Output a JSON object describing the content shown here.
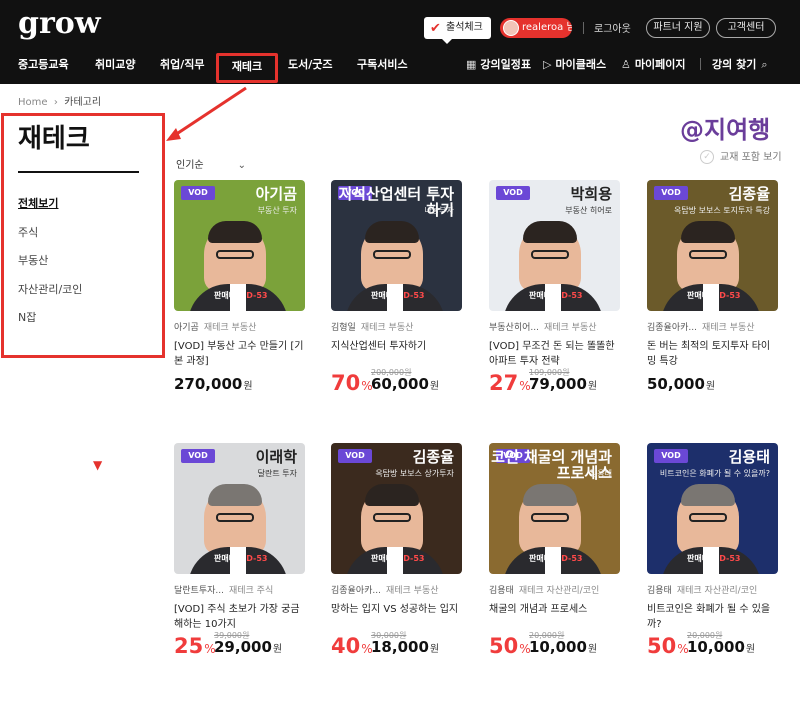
{
  "header": {
    "logo": "grow",
    "attendance": "출석체크",
    "username": "realeroa 님 ›",
    "logout": "로그아웃",
    "partner": "파트너 지원",
    "support": "고객센터",
    "nav": [
      "중고등교육",
      "취미교양",
      "취업/직무",
      "재테크",
      "도서/굿즈",
      "구독서비스"
    ],
    "nav_right": [
      "강의일정표",
      "마이클래스",
      "마이페이지",
      "강의 찾기"
    ]
  },
  "breadcrumb": {
    "home": "Home",
    "current": "카테고리"
  },
  "sidebar": {
    "title": "재테크",
    "items": [
      "전체보기",
      "주식",
      "부동산",
      "자산관리/코인",
      "N잡"
    ]
  },
  "watermark": "@지여행",
  "sort": {
    "label": "인기순"
  },
  "textbook_toggle": "교재 포함 보기",
  "products": [
    {
      "vod": "VOD",
      "thumb_name": "아기곰",
      "thumb_sub": "부동산 투자",
      "deadline": "판매마감",
      "dday": "D-53",
      "instructor": "아기곰",
      "category": "재테크 부동산",
      "title": "[VOD] 부동산 고수 만들기 [기본 과정]",
      "discount": "",
      "original": "",
      "price": "270,000",
      "bg": "#7ba23a"
    },
    {
      "vod": "VOD",
      "thumb_name": "지식산업센터 투자하기",
      "thumb_sub": "나눔부자",
      "deadline": "판매마감",
      "dday": "D-53",
      "instructor": "김형일",
      "category": "재테크 부동산",
      "title": "지식산업센터 투자하기",
      "discount": "70",
      "original": "200,000원",
      "price": "60,000",
      "bg": "#2b3240"
    },
    {
      "vod": "VOD",
      "thumb_name": "박희용",
      "thumb_sub": "부동산 히어로",
      "deadline": "판매마감",
      "dday": "D-53",
      "instructor": "부동산히어...",
      "category": "재테크 부동산",
      "title": "[VOD] 무조건 돈 되는 똘똘한 아파트 투자 전략",
      "discount": "27",
      "original": "109,000원",
      "price": "79,000",
      "bg": "#e9ecf0"
    },
    {
      "vod": "VOD",
      "thumb_name": "김종율",
      "thumb_sub": "옥탑방 보보스 토지투자 특강",
      "deadline": "판매마감",
      "dday": "D-53",
      "instructor": "김종율아카...",
      "category": "재테크 부동산",
      "title": "돈 버는 최적의 토지투자 타이밍 특강",
      "discount": "",
      "original": "",
      "price": "50,000",
      "bg": "#6b5a2a"
    },
    {
      "vod": "VOD",
      "thumb_name": "이래학",
      "thumb_sub": "달란트 투자",
      "deadline": "판매마감",
      "dday": "D-53",
      "instructor": "달란트투자...",
      "category": "재테크 주식",
      "title": "[VOD] 주식 초보가 가장 궁금해하는 10가지",
      "discount": "25",
      "original": "39,000원",
      "price": "29,000",
      "bg": "#d9dadc"
    },
    {
      "vod": "VOD",
      "thumb_name": "김종율",
      "thumb_sub": "옥탑방 보보스 상가투자",
      "deadline": "판매마감",
      "dday": "D-53",
      "instructor": "김종율아카...",
      "category": "재테크 부동산",
      "title": "망하는 입지 VS 성공하는 입지",
      "discount": "40",
      "original": "30,000원",
      "price": "18,000",
      "bg": "#3b2a1e"
    },
    {
      "vod": "VOD",
      "thumb_name": "코인 채굴의 개념과 프로세스",
      "thumb_sub": "김용태",
      "deadline": "판매마감",
      "dday": "D-53",
      "instructor": "김용태",
      "category": "재테크 자산관리/코인",
      "title": "채굴의 개념과 프로세스",
      "discount": "50",
      "original": "20,000원",
      "price": "10,000",
      "bg": "#8a6a30"
    },
    {
      "vod": "VOD",
      "thumb_name": "김용태",
      "thumb_sub": "비트코인은 화폐가 될 수 있을까?",
      "deadline": "판매마감",
      "dday": "D-53",
      "instructor": "김용태",
      "category": "재테크 자산관리/코인",
      "title": "비트코인은 화폐가 될 수 있을까?",
      "discount": "50",
      "original": "20,000원",
      "price": "10,000",
      "bg": "#1d2f6b"
    }
  ],
  "currency": "원",
  "percent": "%",
  "colors": {
    "accent": "#e5322d",
    "vod": "#6b48d6",
    "discount": "#f03c3c",
    "watermark": "#6a3d9a"
  }
}
